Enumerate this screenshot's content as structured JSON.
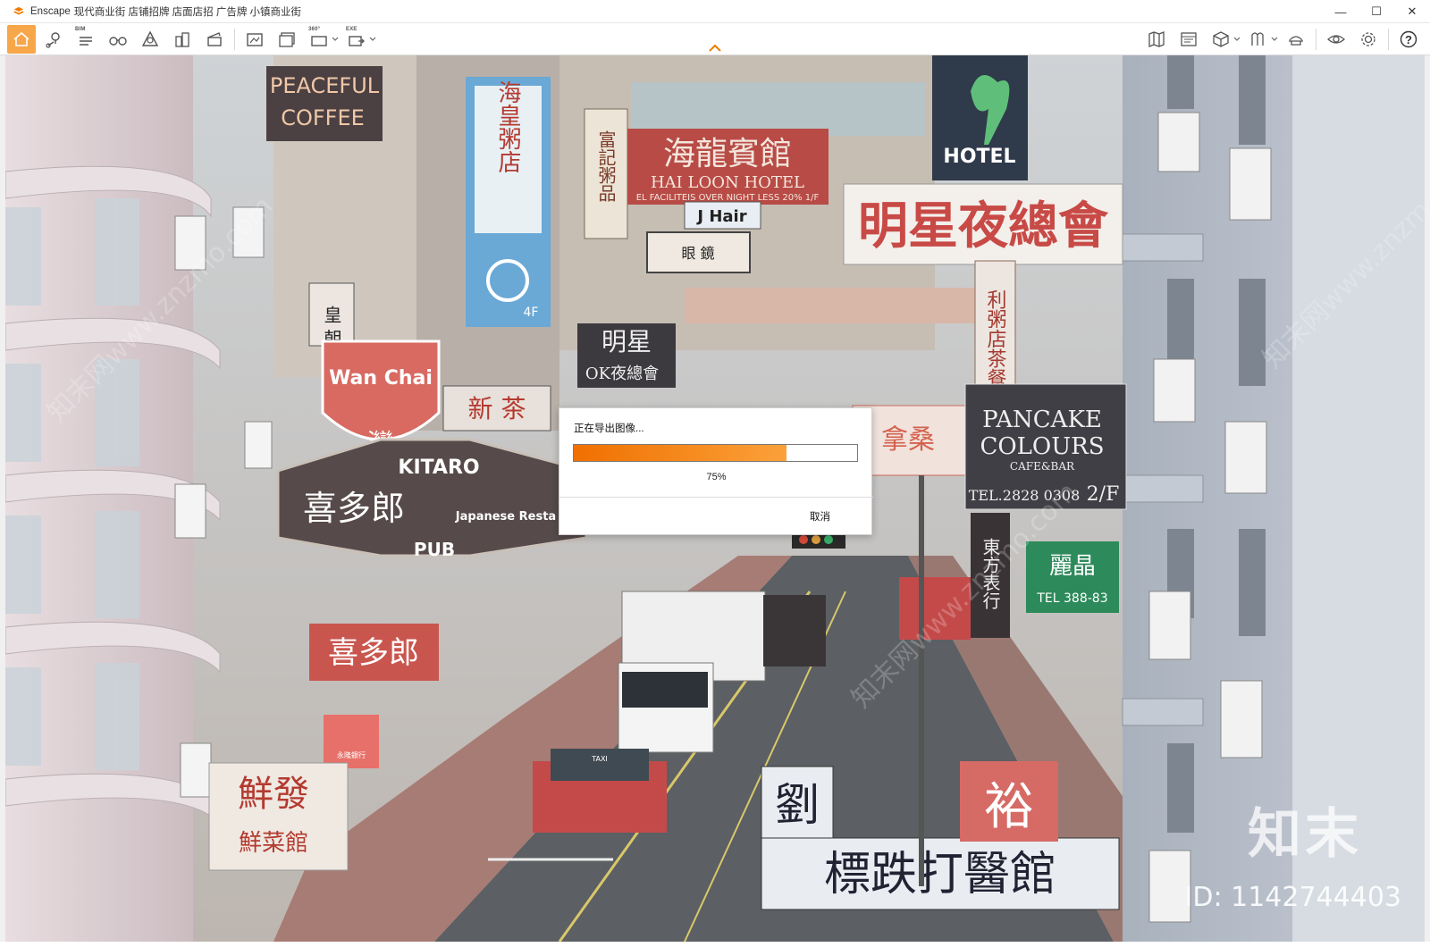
{
  "window": {
    "app_name": "Enscape",
    "title": "现代商业街 店铺招牌 店面店招 广告牌 小镇商业街",
    "controls": {
      "minimize": "—",
      "maximize": "☐",
      "close": "✕"
    }
  },
  "toolbar": {
    "left_icons": [
      "home-icon",
      "location-pin-icon",
      "bim-icon",
      "binoculars-icon",
      "atmosphere-icon",
      "buildings-icon",
      "clapperboard-icon",
      "screenshot-icon",
      "batch-render-icon",
      "panorama-360-icon",
      "exe-export-icon"
    ],
    "bim_badge": "BIM",
    "pano_badge": "360°",
    "exe_badge": "EXE",
    "right_icons": [
      "map-icon",
      "image-icon",
      "asset-cube-icon",
      "material-icon",
      "hat-icon",
      "view-eye-icon",
      "settings-gear-icon",
      "help-icon"
    ],
    "help_label": "?",
    "active_color": "#f7a64a"
  },
  "scene": {
    "signs": {
      "peaceful": "PEACEFUL",
      "coffee": "COFFEE",
      "hotel": "HOTEL",
      "hailong": "海龍賓館",
      "hailong_en": "HAI LOON HOTEL",
      "hailong_sub": "EL FACILITEIS OVER NIGHT LESS 20% 1/F",
      "haihuang": "海皇粥店",
      "haihuang_floor": "4F",
      "fuji": "富記粥品",
      "jhair": "J Hair",
      "yanjing": "眼 鏡",
      "mingxing": "明星夜總會",
      "wanchai": "Wan Chai",
      "wan": "灣",
      "huangzhou": "皇 朝",
      "kitaro": "KITARO",
      "xiduolang": "喜多郎",
      "pub": "PUB",
      "japanese": "Japanese Resta",
      "xiduolang2": "喜多郎",
      "pancake1": "PANCAKE",
      "pancake2": "COLOURS",
      "pancake3": "CAFE&BAR",
      "pancake_tel": "TEL.2828 0308",
      "pancake_floor": "2/F",
      "dongfang": "東方表行",
      "liju": "麗晶",
      "liju_tel": "TEL 388-83",
      "liu": "劉",
      "dieda": "標跌打醫館",
      "yu": "裕",
      "xianfa": "鮮發",
      "xiancai": "鮮菜館",
      "xincha": "新 茶",
      "ok": "OK夜總會",
      "nasang": "拿桑",
      "bank": "永隆銀行",
      "lizhou": "利粥店茶餐",
      "ming": "明星",
      "taxi": "TAXI"
    }
  },
  "dialog": {
    "title": "正在导出图像...",
    "progress_percent": 75,
    "progress_label": "75%",
    "cancel_label": "取消"
  },
  "watermark": {
    "logo": "知末",
    "id_text": "ID: 1142744403",
    "diag": "知末网www.znzmo.com"
  }
}
